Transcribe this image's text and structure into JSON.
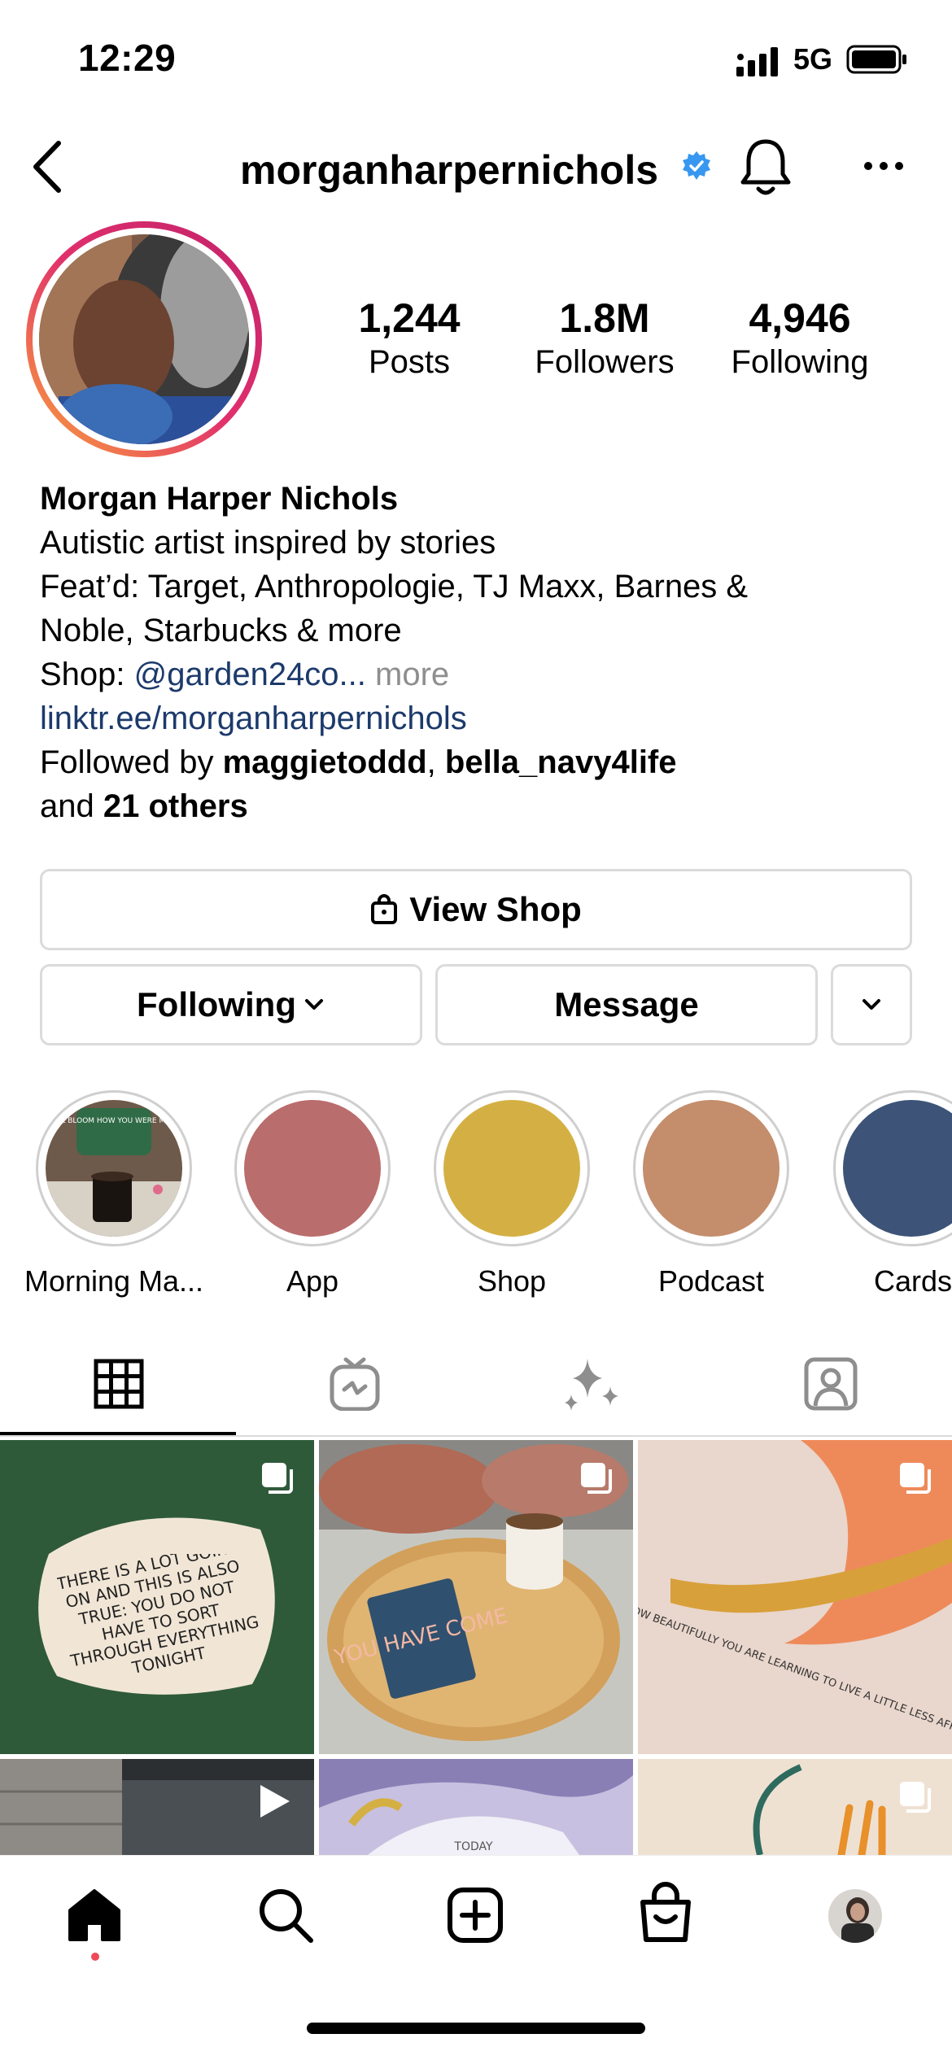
{
  "status_bar": {
    "time": "12:29",
    "network": "5G"
  },
  "header": {
    "username": "morganharpernichols",
    "back_icon": "chevron-left-icon",
    "bell_icon": "bell-icon",
    "more_icon": "more-horizontal-icon"
  },
  "stats": [
    {
      "value": "1,244",
      "label": "Posts"
    },
    {
      "value": "1.8M",
      "label": "Followers"
    },
    {
      "value": "4,946",
      "label": "Following"
    }
  ],
  "bio": {
    "name": "Morgan Harper Nichols",
    "line1": "Autistic artist inspired by stories",
    "line2": "Feat’d: Target, Anthropologie, TJ Maxx, Barnes &",
    "line3": "Noble, Starbucks & more",
    "shop_prefix": "Shop: ",
    "shop_handle": "@garden24co...",
    "more": " more",
    "link": "linktr.ee/morganharpernichols",
    "followed_prefix": "Followed by ",
    "follower1": "maggietoddd",
    "separator": ", ",
    "follower2": "bella_navy4life",
    "and": "and ",
    "others": "21 others"
  },
  "buttons": {
    "view_shop": "View Shop",
    "following": "Following",
    "message": "Message"
  },
  "highlights": [
    {
      "label": "Morning Ma...",
      "color": "#3a3a30"
    },
    {
      "label": "App",
      "color": "#b96d6c"
    },
    {
      "label": "Shop",
      "color": "#d4b044"
    },
    {
      "label": "Podcast",
      "color": "#c48d6c"
    },
    {
      "label": "Cards",
      "color": "#3d5378"
    }
  ],
  "post1_text": "THERE IS A LOT GOING ON AND THIS IS ALSO TRUE: YOU DO NOT HAVE TO SORT THROUGH EVERYTHING TONIGHT",
  "post2_text": "YOU HAVE COME",
  "post3_text": "O HOW BEAUTIFULLY YOU ARE LEARNING TO LIVE A LITTLE LESS AFRAID",
  "highlight1_text": "YOU WILL BLOOM HOW YOU WERE MEANT TO",
  "post_partial_text": "TODAY",
  "colors": {
    "link": "#1c3a6b",
    "verified": "#3897f0",
    "notification": "#ed4956"
  }
}
